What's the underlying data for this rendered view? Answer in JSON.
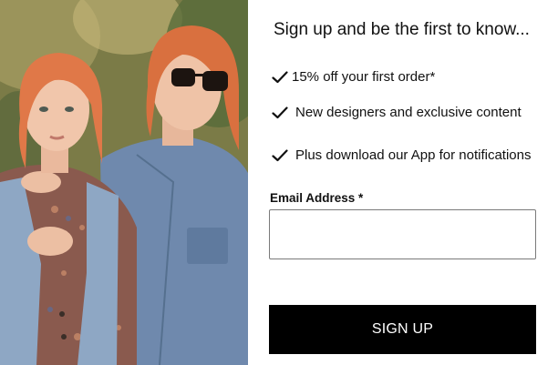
{
  "hero": {
    "image_description_icon": "fashion-models-photo"
  },
  "signup": {
    "headline": "Sign up and be the first to know...",
    "benefits": [
      {
        "icon": "check-icon",
        "text": "15% off your first order*"
      },
      {
        "icon": "check-icon",
        "text": "New designers and exclusive content"
      },
      {
        "icon": "check-icon",
        "text": "Plus download our App for notifications"
      }
    ],
    "email_label": "Email Address *",
    "email_value": "",
    "email_placeholder": "",
    "button_label": "SIGN UP"
  },
  "colors": {
    "button_bg": "#000000",
    "button_text": "#ffffff",
    "text": "#111111",
    "input_border": "#7a7a7a"
  }
}
